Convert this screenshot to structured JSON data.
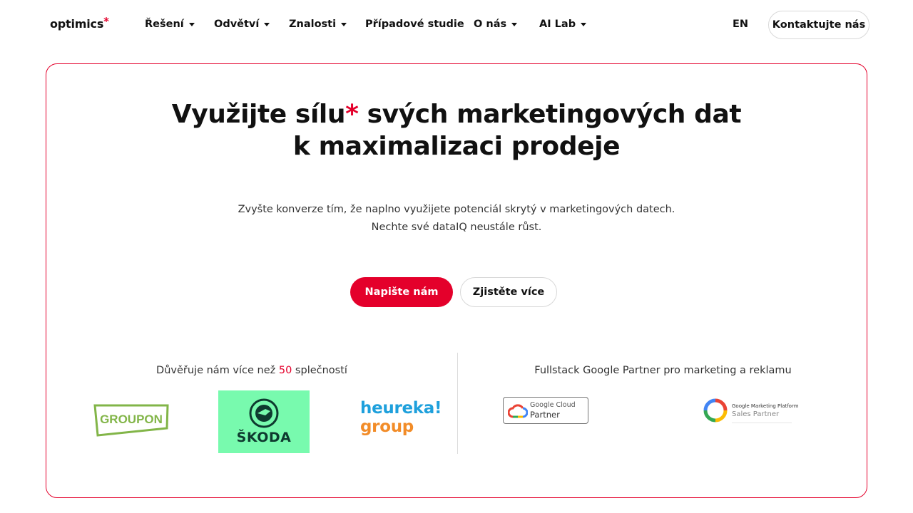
{
  "brand": {
    "name": "optimics",
    "asterisk": "*",
    "accent": "#e4002b"
  },
  "nav": {
    "items": [
      {
        "label": "Řešení",
        "dropdown": true
      },
      {
        "label": "Odvětví",
        "dropdown": true
      },
      {
        "label": "Znalosti",
        "dropdown": true
      },
      {
        "label": "Případové studie",
        "dropdown": false
      },
      {
        "label": "O nás",
        "dropdown": true
      },
      {
        "label": "AI Lab",
        "dropdown": true
      }
    ],
    "lang": "EN",
    "contact": "Kontaktujte nás"
  },
  "hero": {
    "headline_part1": "Využijte sílu",
    "asterisk": "*",
    "headline_part2": " svých marketingových dat",
    "headline_line2": "k maximalizaci prodeje",
    "sub_line1": "Zvyšte konverze tím, že naplno využijete potenciál skrytý v marketingových datech.",
    "sub_line2": "Nechte své dataIQ neustále růst.",
    "cta_primary": "Napište nám",
    "cta_secondary": "Zjistěte více"
  },
  "trust": {
    "prefix": "Důvěřuje nám více než ",
    "count": "50",
    "suffix": " splečností",
    "logos": [
      {
        "name": "GROUPON",
        "color": "#82b548"
      },
      {
        "name": "ŠKODA",
        "color": "#78faae"
      },
      {
        "line1": "heureka!",
        "line2": "group"
      }
    ]
  },
  "partners": {
    "title": "Fullstack Google Partner pro marketing a reklamu",
    "google_cloud": {
      "line1": "Google Cloud",
      "line2": "Partner"
    },
    "gmp": {
      "line1": "Google Marketing Platform",
      "line2": "Sales Partner"
    }
  }
}
